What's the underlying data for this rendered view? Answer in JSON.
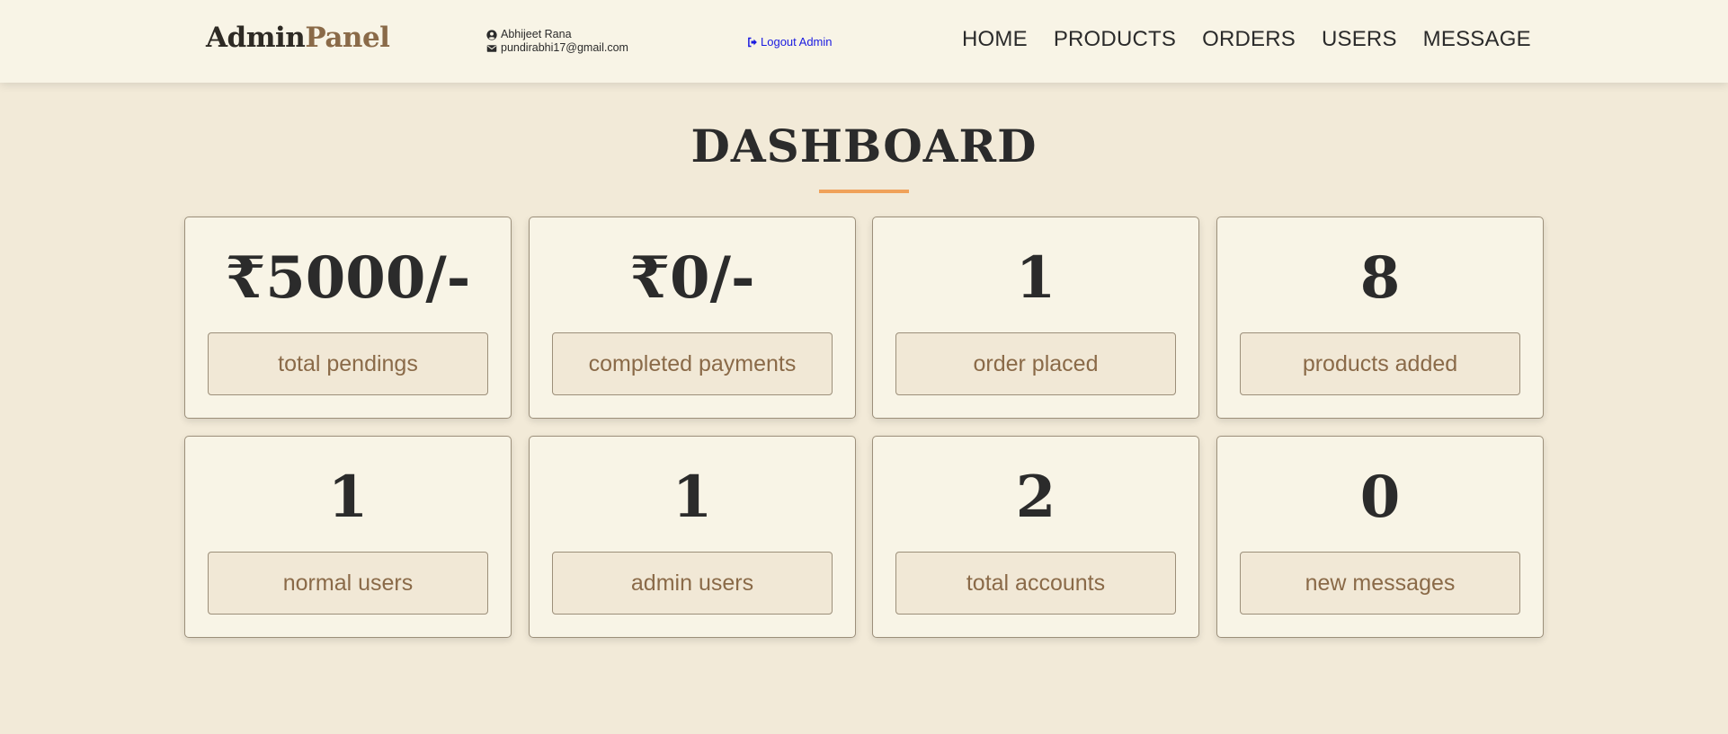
{
  "header": {
    "logo_part1": "Admin",
    "logo_part2": "Panel",
    "user_name": "Abhijeet Rana",
    "user_email": "pundirabhi17@gmail.com",
    "logout_label": "Logout Admin",
    "nav": [
      "HOME",
      "PRODUCTS",
      "ORDERS",
      "USERS",
      "MESSAGE"
    ]
  },
  "page_title": "DASHBOARD",
  "cards": [
    {
      "value": "₹5000/-",
      "label": "total pendings"
    },
    {
      "value": "₹0/-",
      "label": "completed payments"
    },
    {
      "value": "1",
      "label": "order placed"
    },
    {
      "value": "8",
      "label": "products added"
    },
    {
      "value": "1",
      "label": "normal users"
    },
    {
      "value": "1",
      "label": "admin users"
    },
    {
      "value": "2",
      "label": "total accounts"
    },
    {
      "value": "0",
      "label": "new messages"
    }
  ],
  "colors": {
    "background": "#f2ead8",
    "header_bg": "#f8f4e6",
    "accent_brown": "#8a6a48",
    "underline_orange": "#f0a25a",
    "link_blue": "#1a1ae0"
  }
}
